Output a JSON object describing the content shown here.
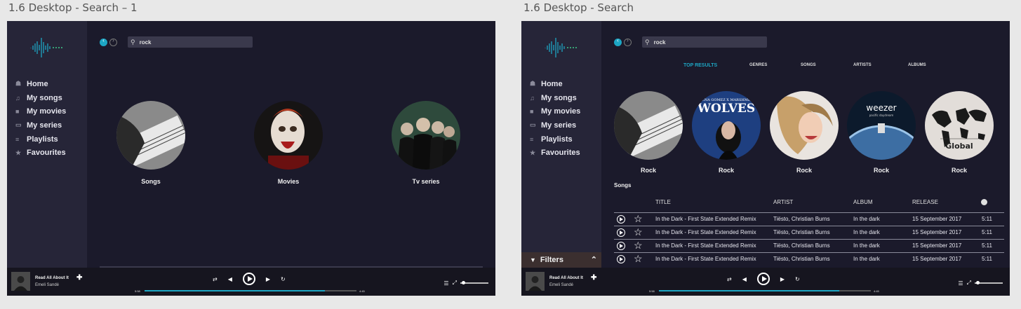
{
  "screens": [
    {
      "label": "1.6 Desktop - Search – 1"
    },
    {
      "label": "1.6 Desktop - Search"
    }
  ],
  "sidebar": {
    "items": [
      {
        "label": "Home",
        "icon": "home-icon"
      },
      {
        "label": "My songs",
        "icon": "music-note-icon"
      },
      {
        "label": "My movies",
        "icon": "video-camera-icon"
      },
      {
        "label": "My series",
        "icon": "monitor-icon"
      },
      {
        "label": "Playlists",
        "icon": "list-icon"
      },
      {
        "label": "Favourites",
        "icon": "star-icon"
      }
    ]
  },
  "search": {
    "value": "rock"
  },
  "categories": [
    {
      "label": "Songs"
    },
    {
      "label": "Movies"
    },
    {
      "label": "Tv series"
    }
  ],
  "tabs": [
    "TOP RESULTS",
    "GENRES",
    "SONGS",
    "ARTISTS",
    "ALBUMS"
  ],
  "results": [
    {
      "label": "Rock"
    },
    {
      "label": "Rock",
      "art_text": "WOLVES",
      "art_subtext": "SELENA GOMEZ X MARSHMELLO"
    },
    {
      "label": "Rock"
    },
    {
      "label": "Rock",
      "art_text": "weezer",
      "art_subtext": "pacific daydream"
    },
    {
      "label": "Rock",
      "art_text": "Global"
    }
  ],
  "songs": {
    "heading": "Songs",
    "columns": {
      "title": "TITLE",
      "artist": "ARTIST",
      "album": "ALBUM",
      "release": "RELEASE"
    },
    "rows": [
      {
        "title": "In the Dark - First State Extended Remix",
        "artist": "Tiësto, Christian Burns",
        "album": "In the dark",
        "release": "15 September 2017",
        "duration": "5:11"
      },
      {
        "title": "In the Dark - First State Extended Remix",
        "artist": "Tiësto, Christian Burns",
        "album": "In the dark",
        "release": "15 September 2017",
        "duration": "5:11"
      },
      {
        "title": "In the Dark - First State Extended Remix",
        "artist": "Tiësto, Christian Burns",
        "album": "In the dark",
        "release": "15 September 2017",
        "duration": "5:11"
      },
      {
        "title": "In the Dark - First State Extended Remix",
        "artist": "Tiësto, Christian Burns",
        "album": "In the dark",
        "release": "15 September 2017",
        "duration": "5:11"
      }
    ]
  },
  "filters": {
    "label": "Filters"
  },
  "player": {
    "track": "Read All About It",
    "artist": "Emeli Sandé",
    "elapsed": "5:58",
    "total": "4:45",
    "progress_fraction": 0.85,
    "volume_fraction": 0.1
  },
  "colors": {
    "accent": "#1da6c4",
    "background": "#1b1a2b",
    "sidebar": "#262538"
  }
}
